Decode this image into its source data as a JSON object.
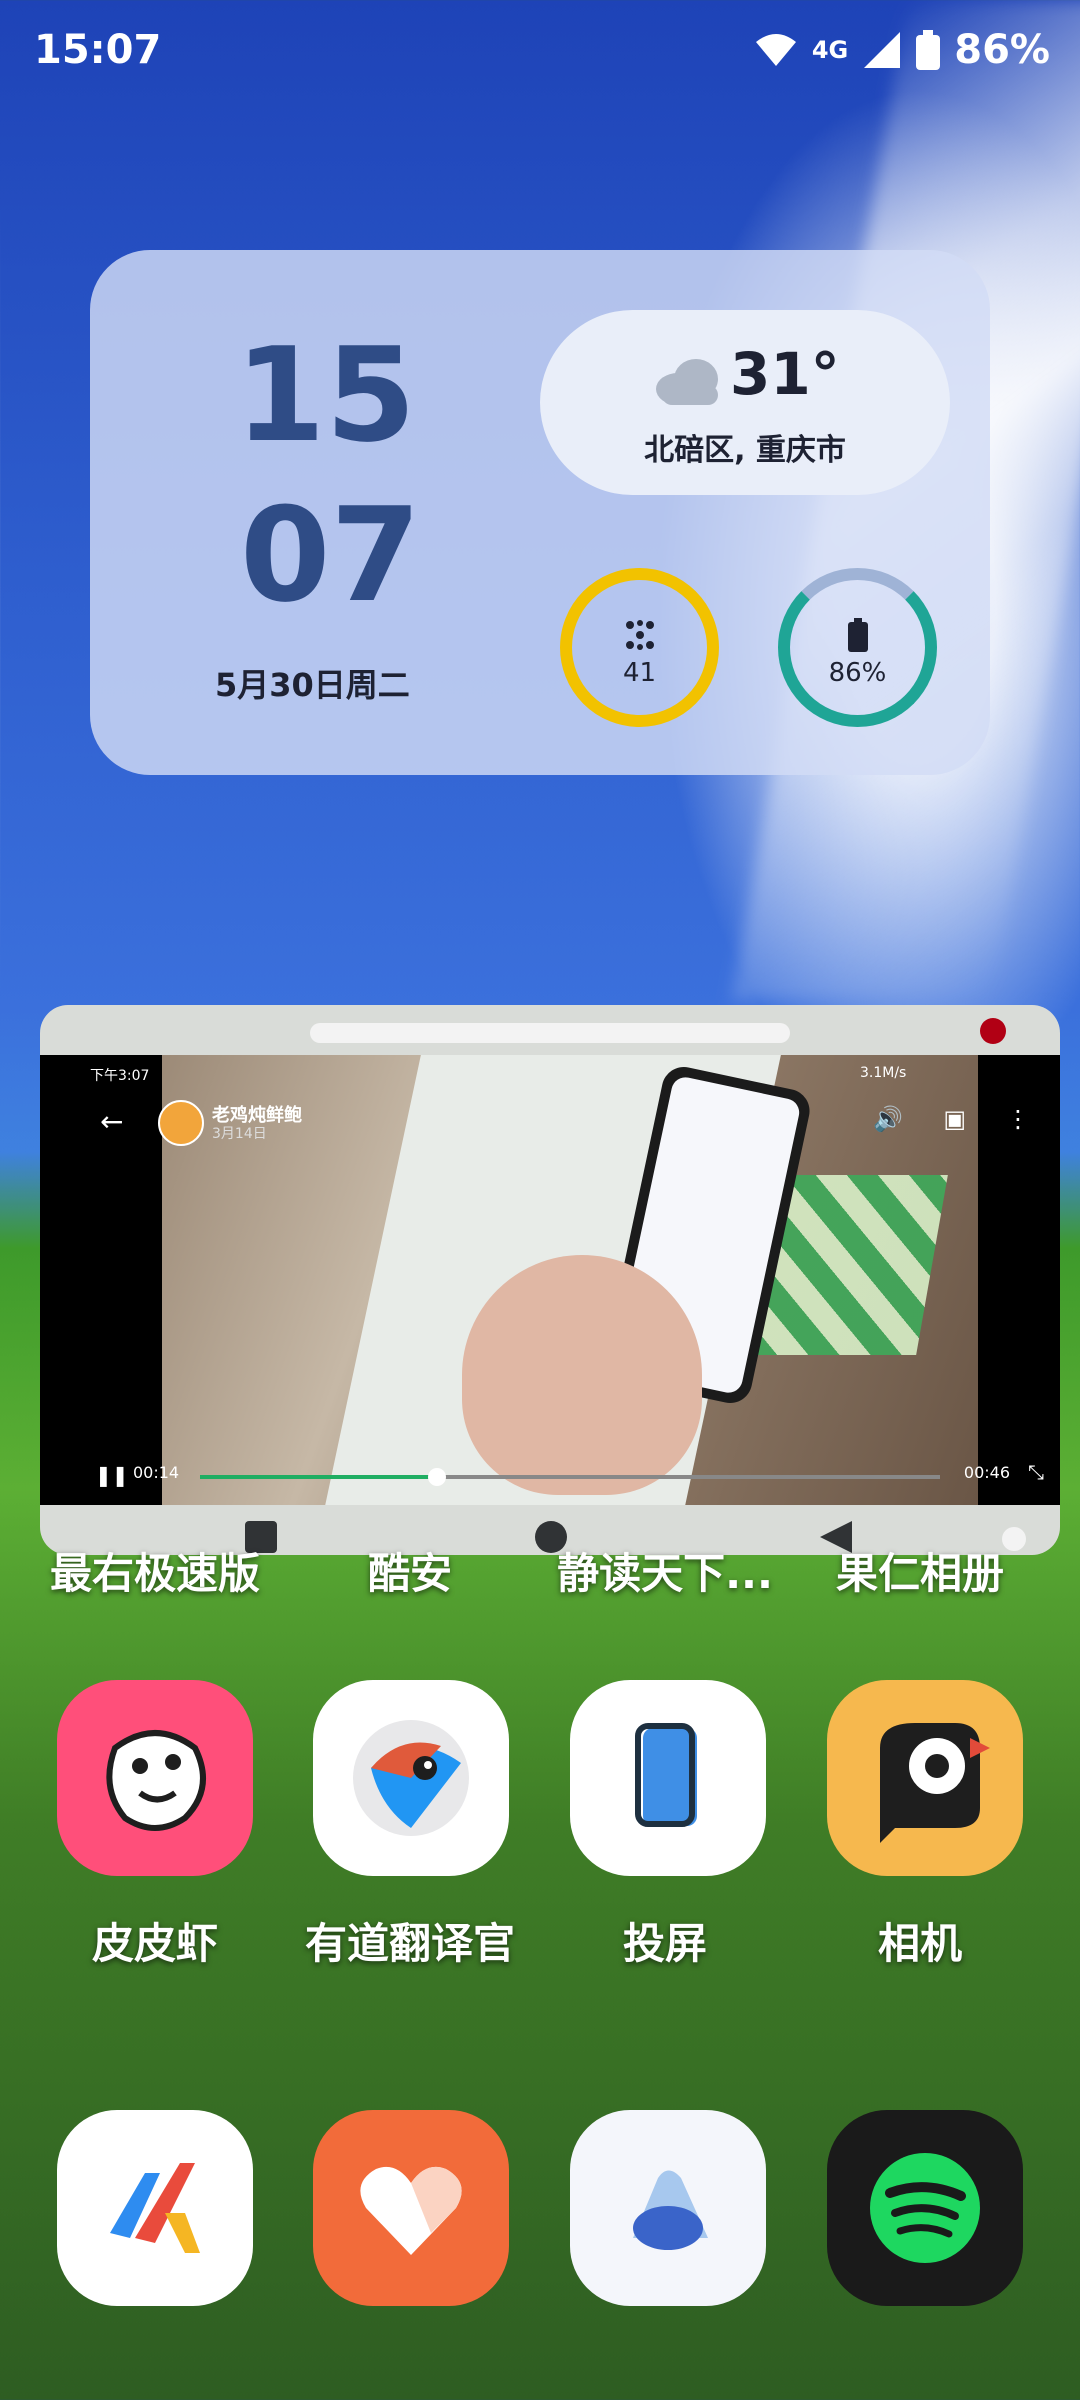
{
  "status": {
    "time": "15:07",
    "network": "4G",
    "battery": "86%"
  },
  "widget": {
    "hour": "15",
    "minute": "07",
    "date": "5月30日周二",
    "weather": {
      "temp": "31°",
      "location": "北碚区, 重庆市"
    },
    "air": {
      "value": "41"
    },
    "battery": {
      "value": "86%",
      "level": 0.86
    }
  },
  "pip": {
    "video": {
      "status_time": "下午3:07",
      "status_speed": "3.1M/s",
      "uploader": "老鸡炖鲜鲍",
      "date": "3月14日",
      "elapsed": "00:14",
      "duration": "00:46",
      "progress": 0.32
    }
  },
  "row1_labels": [
    "最右极速版",
    "酷安",
    "静读天下...",
    "果仁相册"
  ],
  "apps": [
    {
      "label": "皮皮虾",
      "icon": "pipixia-icon",
      "color": "#ff4f7a"
    },
    {
      "label": "有道翻译官",
      "icon": "youdao-icon",
      "color": "#ffffff"
    },
    {
      "label": "投屏",
      "icon": "cast-screen-icon",
      "color": "#ffffff"
    },
    {
      "label": "相机",
      "icon": "camera-bird-icon",
      "color": "#f6b84e"
    }
  ],
  "dock": [
    {
      "icon": "maps-arrow-icon"
    },
    {
      "icon": "heart-health-icon"
    },
    {
      "icon": "cloud-drive-icon"
    },
    {
      "icon": "spotify-icon"
    }
  ]
}
